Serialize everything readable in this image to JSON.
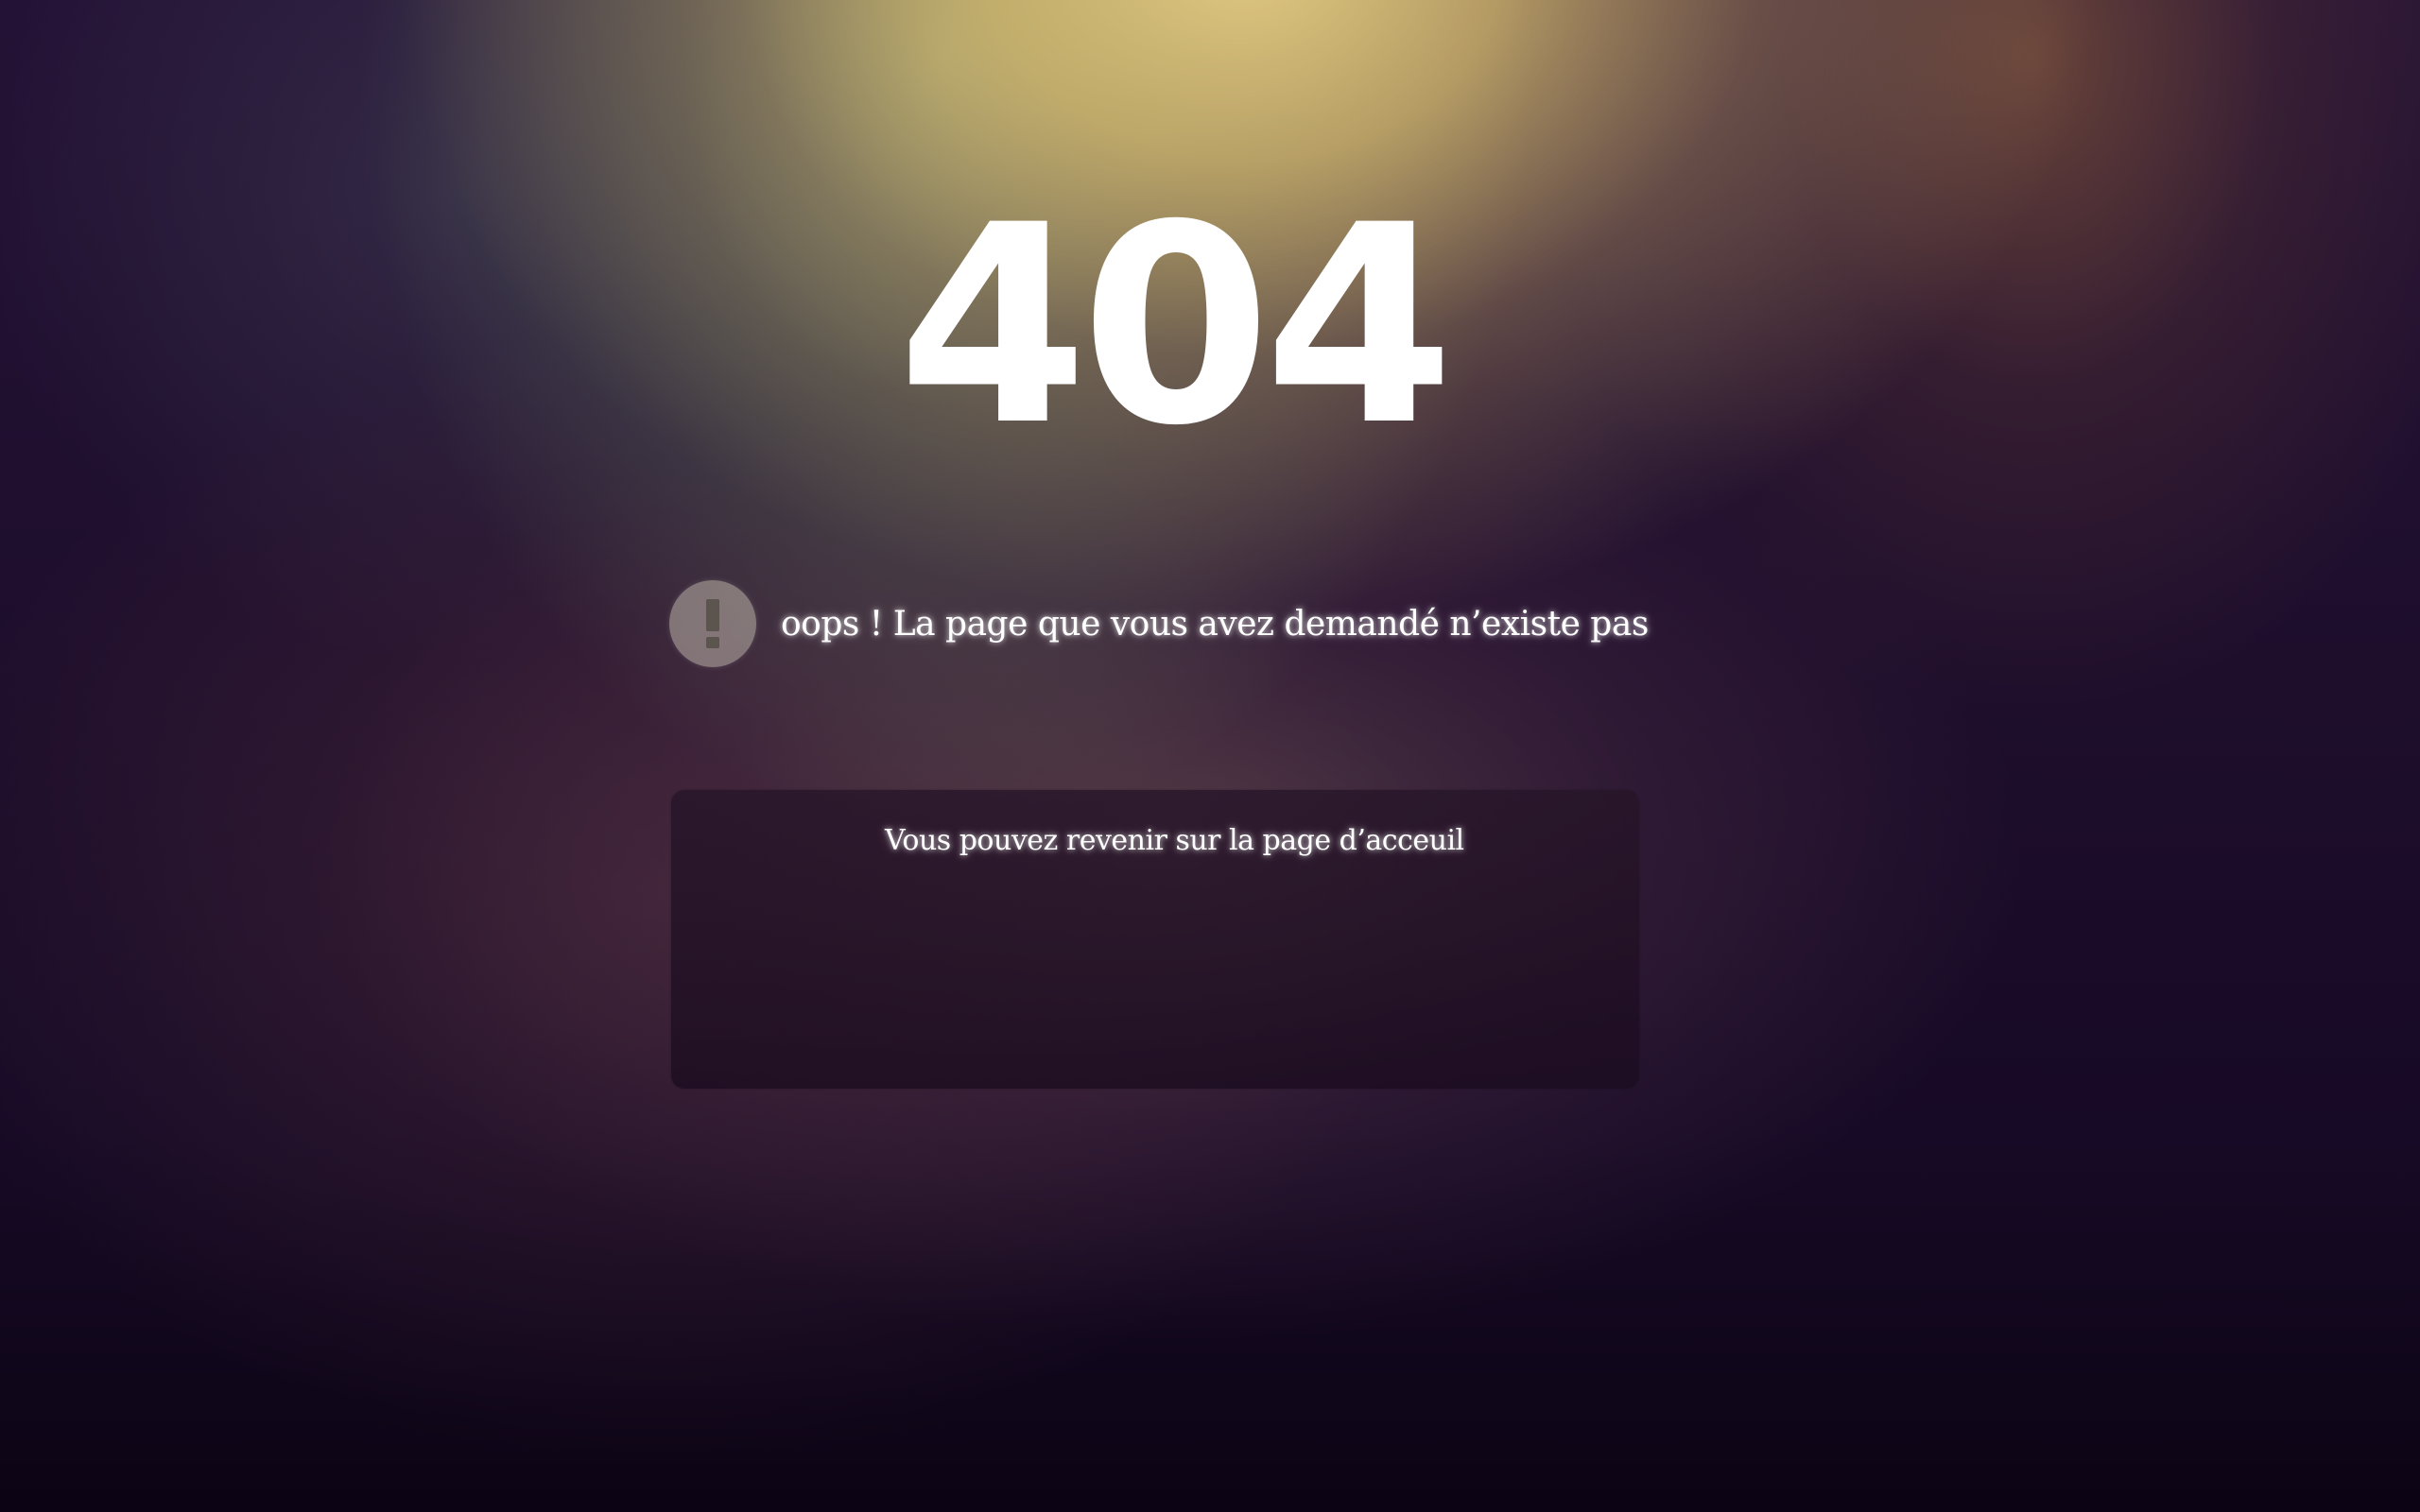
{
  "error": {
    "code": "404",
    "message": "oops ! La page que vous avez demandé n’existe pas"
  },
  "home": {
    "link_label": "Vous pouvez revenir sur la page d’acceuil"
  },
  "colors": {
    "text": "#ffffff",
    "icon_background": "#bfb4aa",
    "box_background": "#261428"
  },
  "icons": {
    "alert": "exclamation-icon"
  }
}
